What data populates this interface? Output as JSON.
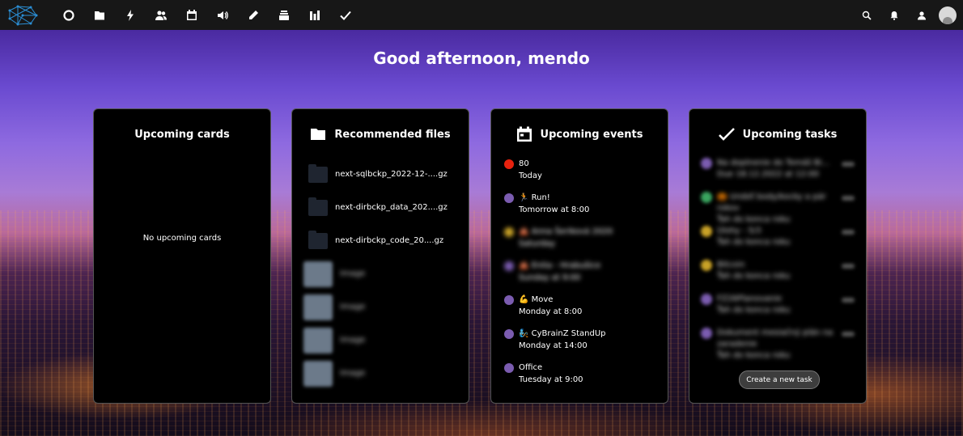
{
  "greeting": "Good afternoon, mendo",
  "colors": {
    "topbar": "#171717",
    "panel": "#000000",
    "event_red": "#e8220e",
    "event_purple": "#7b5cb0",
    "event_yellow": "#c9a227",
    "task_green": "#3aa55f"
  },
  "topbar": {
    "logo": "nextcloud-network-logo-icon",
    "apps": [
      "dashboard-icon",
      "files-icon",
      "activity-icon",
      "contacts-icon",
      "calendar-icon",
      "audio-icon",
      "notes-icon",
      "deck-icon",
      "analytics-icon",
      "tasks-icon"
    ],
    "right": [
      "search-icon",
      "notifications-icon",
      "contacts-menu-icon",
      "user-avatar"
    ]
  },
  "panels": {
    "cards": {
      "title": "Upcoming cards",
      "empty": "No upcoming cards"
    },
    "files": {
      "title": "Recommended files",
      "items": [
        {
          "name": "next-sqlbckp_2022-12-....gz"
        },
        {
          "name": "next-dirbckp_data_202....gz"
        },
        {
          "name": "next-dirbckp_code_20....gz"
        },
        {
          "name": "Image"
        },
        {
          "name": "Image"
        },
        {
          "name": "Image"
        },
        {
          "name": "Image"
        }
      ]
    },
    "events": {
      "title": "Upcoming events",
      "items": [
        {
          "title": "80",
          "time": "Today",
          "color": "#e8220e",
          "blurred": false
        },
        {
          "title": "🏃 Run!",
          "time": "Tomorrow at 8:00",
          "color": "#7b5cb0",
          "blurred": false
        },
        {
          "title": "🎪 Anna Šeriková 2020",
          "time": "Saturday",
          "color": "#c9a227",
          "blurred": true
        },
        {
          "title": "🎪 Enita - Hrabušice",
          "time": "Sunday at 9:00",
          "color": "#7b5cb0",
          "blurred": true
        },
        {
          "title": "💪 Move",
          "time": "Monday at 8:00",
          "color": "#7b5cb0",
          "blurred": false
        },
        {
          "title": "🧞 CyBrainZ StandUp",
          "time": "Monday at 14:00",
          "color": "#7b5cb0",
          "blurred": false
        },
        {
          "title": "Office",
          "time": "Tuesday at 9:00",
          "color": "#7b5cb0",
          "blurred": false
        }
      ]
    },
    "tasks": {
      "title": "Upcoming tasks",
      "button": "Create a new task",
      "items": [
        {
          "title": "Na doplnenie do Tomáš Bi...",
          "sub": "Due 18.12.2022 at 12:00",
          "color": "#7b5cb0"
        },
        {
          "title": "🎃 Urobiť body/kocky a pár rokov",
          "sub": "Ťah do konca roku",
          "color": "#3aa55f"
        },
        {
          "title": "Úlohy - 5/3",
          "sub": "Ťah do konca roku",
          "color": "#c9a227"
        },
        {
          "title": "Bitcoin",
          "sub": "Ťah do konca roku",
          "color": "#c9a227"
        },
        {
          "title": "FZ26Planovanie",
          "sub": "Ťah do konca roku",
          "color": "#7b5cb0"
        },
        {
          "title": "Dokument mesiačný plán na zaradenie",
          "sub": "Ťah do konca roku",
          "color": "#7b5cb0"
        }
      ]
    }
  }
}
